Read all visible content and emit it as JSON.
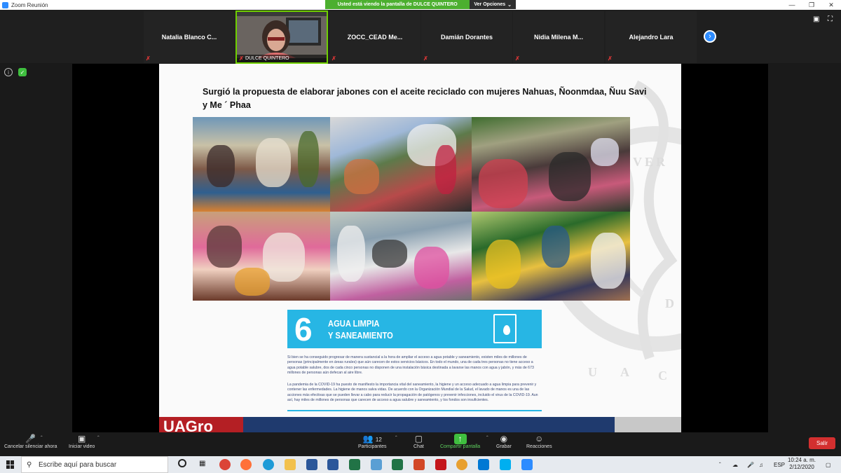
{
  "window": {
    "title": "Zoom Reunión"
  },
  "banner": {
    "message": "Usted está viendo la pantalla de DULCE QUINTERO",
    "view_options": "Ver Opciones"
  },
  "participants": [
    {
      "name": "Natalia  Blanco  C..."
    },
    {
      "name": "DULCE QUINTERO",
      "video": true
    },
    {
      "name": "ZOCC_CEAD  Me..."
    },
    {
      "name": "Damián Dorantes"
    },
    {
      "name": "Nidia  Milena  M..."
    },
    {
      "name": "Alejandro Lara"
    }
  ],
  "slide": {
    "heading": "Surgió la propuesta de elaborar jabones con el aceite reciclado con mujeres Nahuas, Ñoonmdaa, Ñuu Savi y Me ´ Phaa",
    "sdg": {
      "number": "6",
      "title_line1": "AGUA LIMPIA",
      "title_line2": "Y SANEAMIENTO"
    },
    "paragraph1": "Si bien se ha conseguido progresar de manera sustancial a la hora de ampliar el acceso a agua potable y saneamiento, existen miles de millones de personas (principalmente en áreas rurales) que aún carecen de estos servicios básicos. En todo el mundo, una de cada tres personas no tiene acceso a agua potable salubre, dos de cada cinco personas no disponen de una instalación básica destinada a lavarse las manos con agua y jabón, y más de 673 millones de personas aún defecan al aire libre.",
    "paragraph2": "La pandemia de la COVID-19 ha puesto de manifiesto la importancia vital del saneamiento, la higiene y un acceso adecuado a agua limpia para prevenir y contener las enfermedades. La higiene de manos salva vidas. De acuerdo con la Organización Mundial de la Salud, el lavado de manos es una de las acciones más efectivas que se pueden llevar a cabo para reducir la propagación de patógenos y prevenir infecciones, incluido el virus de la COVID-19. Aun así, hay miles de millones de personas que carecen de acceso a agua salubre y saneamiento, y los fondos son insuficientes.",
    "footer_logo": "UAGro"
  },
  "toolbar": {
    "unmute": "Cancelar silenciar ahora",
    "video": "Iniciar video",
    "participants": "Participantes",
    "participants_count": "12",
    "chat": "Chat",
    "share": "Compartir pantalla",
    "record": "Grabar",
    "reactions": "Reacciones",
    "leave": "Salir"
  },
  "taskbar": {
    "search_placeholder": "Escribe aquí para buscar",
    "language": "ESP",
    "time": "10:24 a. m.",
    "date": "2/12/2020"
  }
}
